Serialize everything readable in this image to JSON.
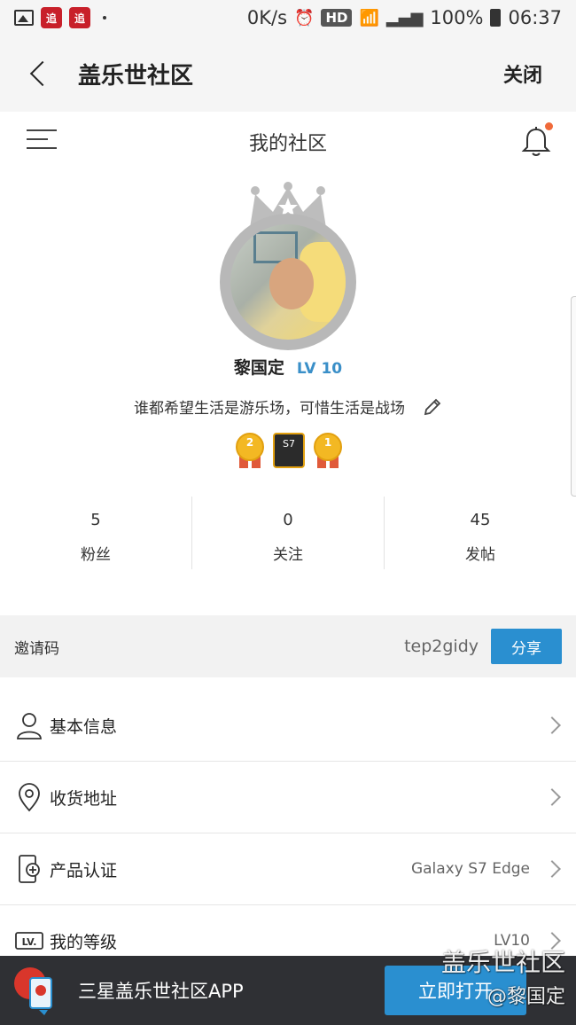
{
  "statusbar": {
    "app_icon1": "追",
    "app_icon2": "追",
    "speed": "0K/s",
    "hd": "HD",
    "battery": "100%",
    "time": "06:37"
  },
  "titlebar": {
    "title": "盖乐世社区",
    "close_label": "关闭"
  },
  "header": {
    "title": "我的社区"
  },
  "profile": {
    "name": "黎国定",
    "level": "LV 10",
    "bio": "谁都希望生活是游乐场，可惜生活是战场",
    "badges": [
      {
        "type": "medal",
        "text": "2"
      },
      {
        "type": "device",
        "text": "S7"
      },
      {
        "type": "medal",
        "text": "1"
      }
    ]
  },
  "stats": [
    {
      "value": "5",
      "label": "粉丝"
    },
    {
      "value": "0",
      "label": "关注"
    },
    {
      "value": "45",
      "label": "发帖"
    }
  ],
  "invite": {
    "label": "邀请码",
    "code": "tep2gidy",
    "share_label": "分享"
  },
  "menu": [
    {
      "icon": "person-icon",
      "label": "基本信息",
      "value": ""
    },
    {
      "icon": "location-pin-icon",
      "label": "收货地址",
      "value": ""
    },
    {
      "icon": "phone-certify-icon",
      "label": "产品认证",
      "value": "Galaxy S7 Edge"
    },
    {
      "icon": "level-badge-icon",
      "label": "我的等级",
      "value": "LV10"
    }
  ],
  "banner": {
    "text": "三星盖乐世社区APP",
    "open_label": "立即打开"
  },
  "watermark": {
    "line1": "盖乐世社区",
    "line2": "@黎国定"
  },
  "colors": {
    "accent": "#2a8fd0",
    "level": "#3a8fc8",
    "notify_dot": "#f06a3a",
    "banner_bg": "#2f3034"
  }
}
